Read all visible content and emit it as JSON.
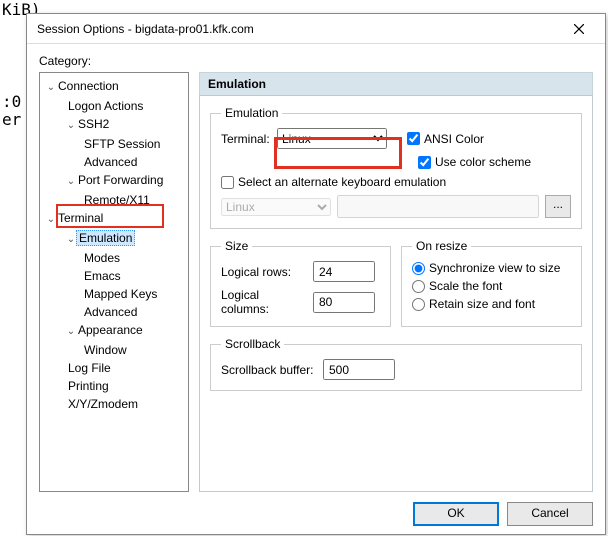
{
  "bg": {
    "l1": "KiB)",
    "l2": ":0",
    "l3": "er"
  },
  "dialog": {
    "title": "Session Options - bigdata-pro01.kfk.com",
    "category_label": "Category:",
    "buttons": {
      "ok": "OK",
      "cancel": "Cancel"
    }
  },
  "tree": {
    "n0": "Connection",
    "n0_0": "Logon Actions",
    "n0_1": "SSH2",
    "n0_1_0": "SFTP Session",
    "n0_1_1": "Advanced",
    "n0_2": "Port Forwarding",
    "n0_2_0": "Remote/X11",
    "n1": "Terminal",
    "n1_0": "Emulation",
    "n1_0_0": "Modes",
    "n1_0_1": "Emacs",
    "n1_0_2": "Mapped Keys",
    "n1_0_3": "Advanced",
    "n1_1": "Appearance",
    "n1_1_0": "Window",
    "n1_2": "Log File",
    "n1_3": "Printing",
    "n1_4": "X/Y/Zmodem"
  },
  "panel": {
    "header": "Emulation",
    "emu": {
      "legend": "Emulation",
      "terminal_label": "Terminal:",
      "terminal_value": "Linux",
      "ansi_label": "ANSI Color",
      "scheme_label": "Use color scheme",
      "alt_label": "Select an alternate keyboard emulation",
      "alt_value": "Linux",
      "dots": "..."
    },
    "size": {
      "legend": "Size",
      "rows_label": "Logical rows:",
      "rows_value": "24",
      "cols_label": "Logical columns:",
      "cols_value": "80"
    },
    "resize": {
      "legend": "On resize",
      "r1": "Synchronize view to size",
      "r2": "Scale the font",
      "r3": "Retain size and font"
    },
    "scroll": {
      "legend": "Scrollback",
      "buf_label": "Scrollback buffer:",
      "buf_value": "500"
    }
  }
}
